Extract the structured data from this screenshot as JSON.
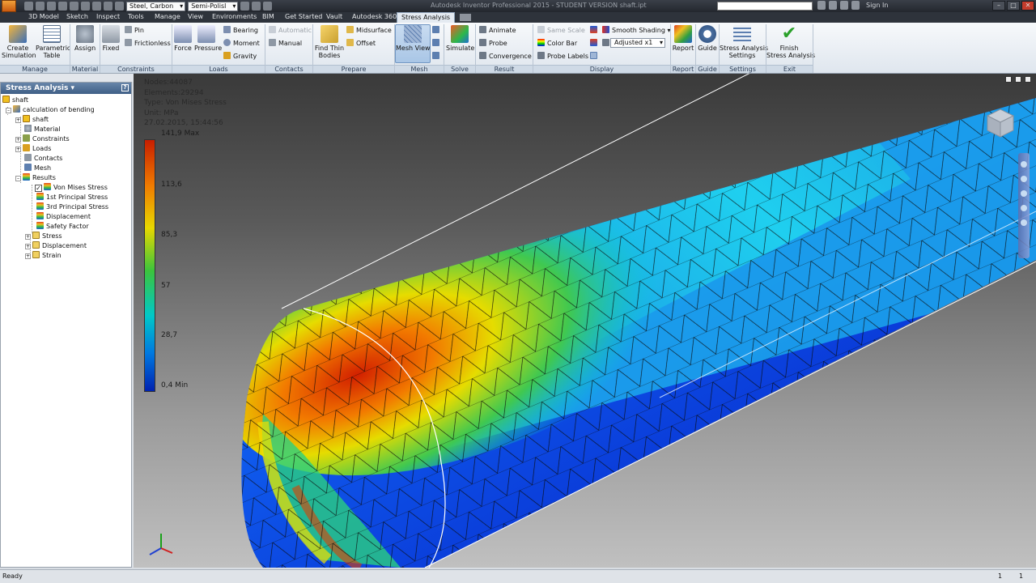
{
  "titlebar": {
    "title": "Autodesk Inventor Professional 2015 - STUDENT VERSION    shaft.ipt",
    "material": "Steel, Carbon",
    "appearance": "Semi-Polisl",
    "signin": "Sign In"
  },
  "tabs": [
    "3D Model",
    "Sketch",
    "Inspect",
    "Tools",
    "Manage",
    "View",
    "Environments",
    "BIM",
    "Get Started",
    "Vault",
    "Autodesk 360",
    "Stress Analysis"
  ],
  "ribbon": {
    "create_simulation": "Create\nSimulation",
    "parametric_table": "Parametric\nTable",
    "assign": "Assign",
    "fixed": "Fixed",
    "pin": "Pin",
    "frictionless": "Frictionless",
    "force": "Force",
    "pressure": "Pressure",
    "bearing": "Bearing",
    "moment": "Moment",
    "gravity": "Gravity",
    "automatic": "Automatic",
    "manual": "Manual",
    "find_thin": "Find Thin\nBodies",
    "midsurface": "Midsurface",
    "offset": "Offset",
    "mesh_view": "Mesh View",
    "simulate": "Simulate",
    "animate": "Animate",
    "probe": "Probe",
    "convergence": "Convergence",
    "same_scale": "Same Scale",
    "color_bar": "Color Bar",
    "probe_labels": "Probe Labels",
    "smooth_shading": "Smooth Shading",
    "adjusted": "Adjusted x1",
    "report": "Report",
    "guide": "Guide",
    "settings": "Stress Analysis\nSettings",
    "finish": "Finish\nStress Analysis",
    "panels": {
      "manage": "Manage",
      "material": "Material",
      "constraints": "Constraints",
      "loads": "Loads",
      "contacts": "Contacts",
      "prepare": "Prepare",
      "mesh": "Mesh",
      "solve": "Solve",
      "result": "Result",
      "display": "Display",
      "report": "Report",
      "guide": "Guide",
      "settings": "Settings",
      "exit": "Exit"
    }
  },
  "browser": {
    "title": "Stress Analysis ▾",
    "items": [
      "shaft",
      "calculation of bending",
      "shaft",
      "Material",
      "Constraints",
      "Loads",
      "Contacts",
      "Mesh",
      "Results",
      "Von Mises Stress",
      "1st Principal Stress",
      "3rd Principal Stress",
      "Displacement",
      "Safety Factor",
      "Stress",
      "Displacement",
      "Strain"
    ]
  },
  "viewport": {
    "nodes": "Nodes:44087",
    "elements": "Elements:29294",
    "type": "Type: Von Mises Stress",
    "unit": "Unit: MPa",
    "date": "27.02.2015, 15:44:56",
    "legend": [
      "141,9 Max",
      "113,6",
      "85,3",
      "57",
      "28,7",
      "0,4 Min"
    ]
  },
  "status": {
    "text": "Ready",
    "n1": "1",
    "n2": "1"
  },
  "colors": {
    "accent": "#6785a9",
    "max": "#c81e00",
    "min": "#0022b0"
  }
}
